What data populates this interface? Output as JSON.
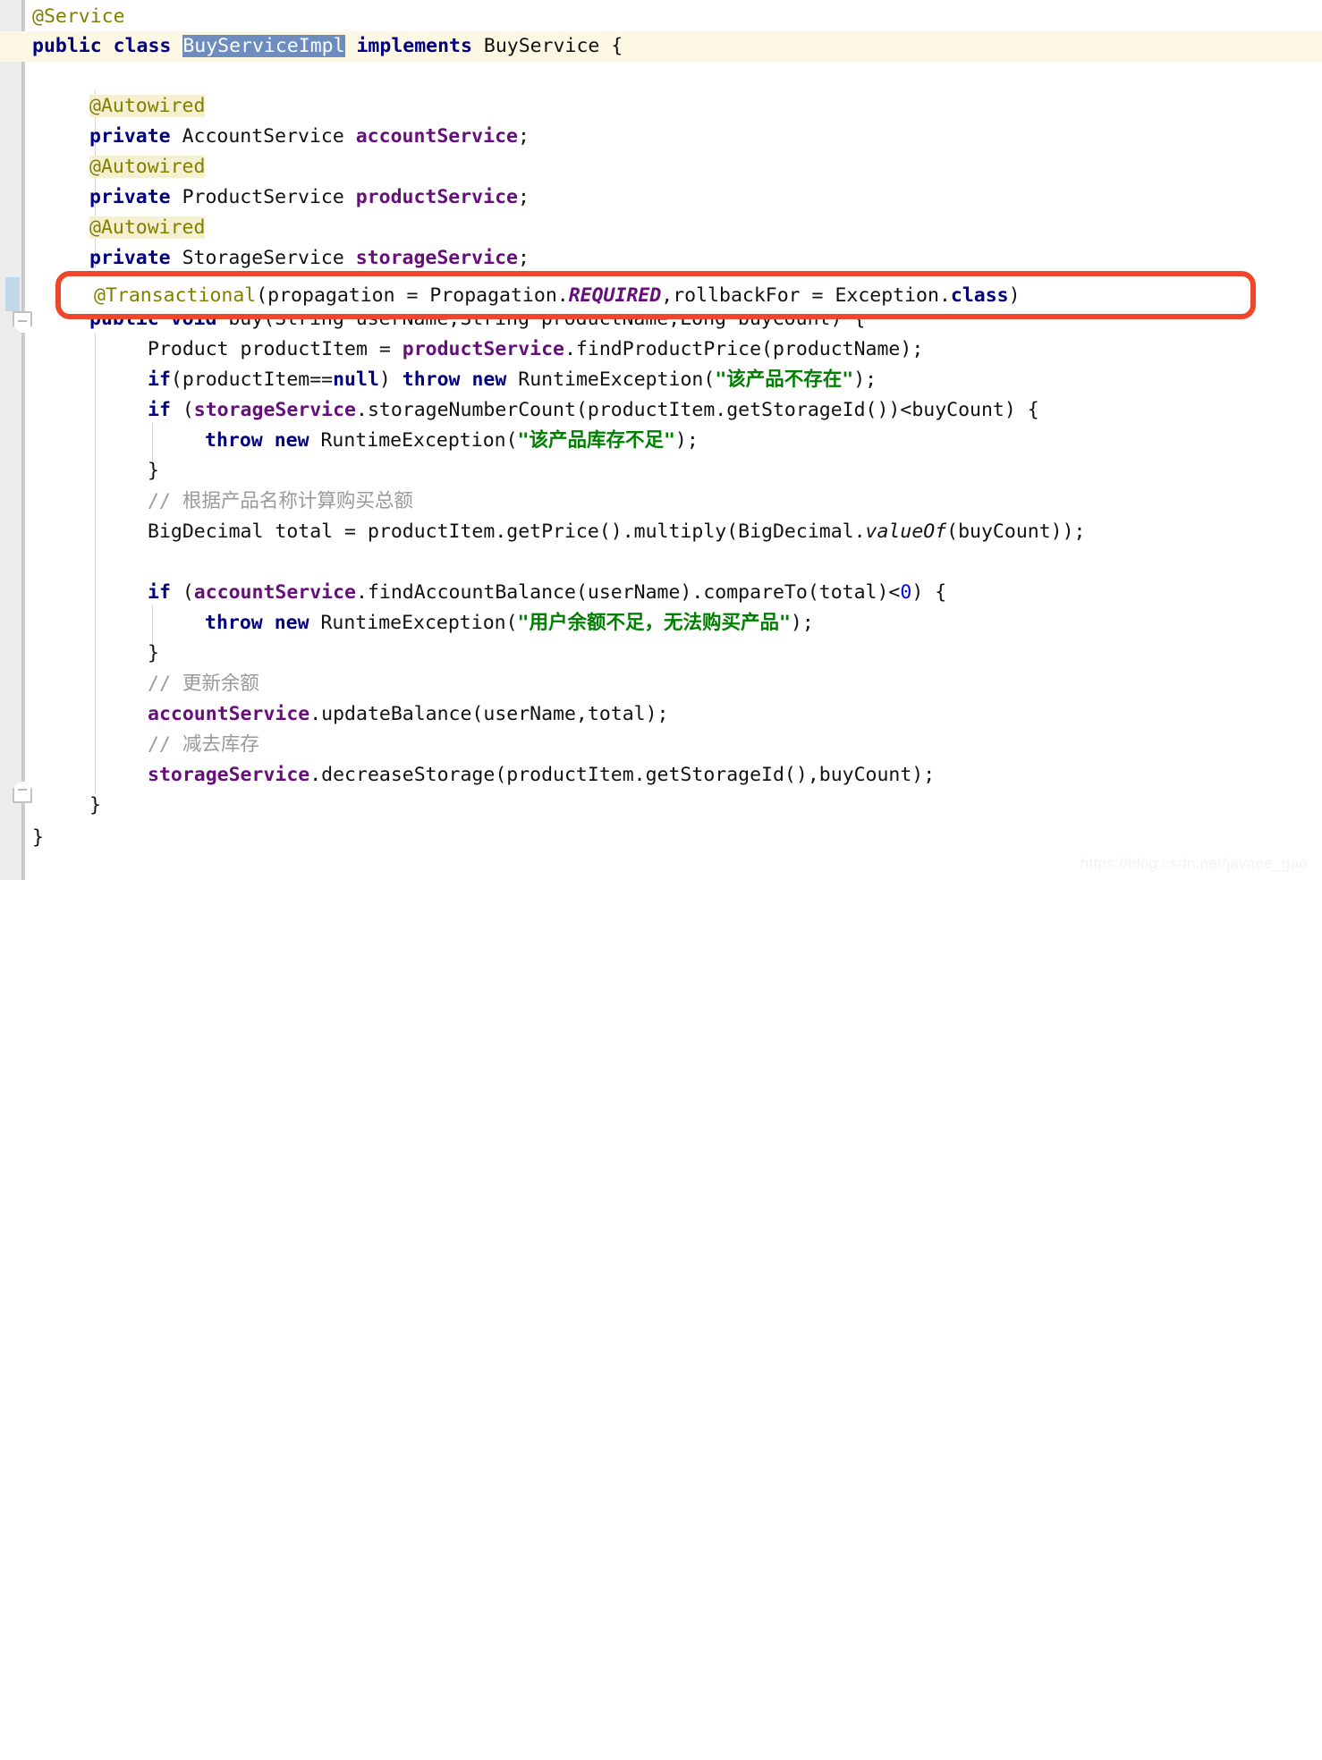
{
  "editor": {
    "watermark": "https://blog.csdn.net/javaee_gao",
    "highlight_box_color": "#f0462c",
    "selection_color": "#6d8cc0",
    "caret_line_color": "#fdf8e4",
    "gutter_color": "#ececec",
    "change_bar_color": "#c3d7ea"
  },
  "code": {
    "line1": {
      "annotation": "@Service"
    },
    "line2": {
      "kw_public": "public",
      "kw_class": "class",
      "class_name": "BuyServiceImpl",
      "kw_implements": "implements",
      "interface_name": "BuyService",
      "brace": "{"
    },
    "line4": {
      "annotation": "@Autowired"
    },
    "line5": {
      "kw_private": "private",
      "type": "AccountService",
      "field": "accountService",
      "semi": ";"
    },
    "line6": {
      "annotation": "@Autowired"
    },
    "line7": {
      "kw_private": "private",
      "type": "ProductService",
      "field": "productService",
      "semi": ";"
    },
    "line8": {
      "annotation": "@Autowired"
    },
    "line9": {
      "kw_private": "private",
      "type": "StorageService",
      "field": "storageService",
      "semi": ";"
    },
    "line10_hidden": "@Transactional(propagation = Propagation.REQUIRED)",
    "line_transactional": {
      "annotation": "@Transactional",
      "open": "(propagation = Propagation.",
      "propagation_value": "REQUIRED",
      "mid": ",rollbackFor = Exception.",
      "kw_class": "class",
      "close": ")"
    },
    "line_signature": {
      "kw_public": "public",
      "kw_void": "void",
      "method": "buy(String userName,String productName,Long buyCount) {"
    },
    "line_product": {
      "prefix": "Product productItem = ",
      "field": "productService",
      "suffix": ".findProductPrice(productName);"
    },
    "line_ifnull": {
      "kw_if": "if",
      "cond_a": "(productItem==",
      "kw_null": "null",
      "cond_b": ") ",
      "kw_throw": "throw",
      "kw_new": "new",
      "call": " RuntimeException(",
      "string": "\"该产品不存在\"",
      "tail": ");"
    },
    "line_ifstorage": {
      "kw_if": "if",
      "open": " (",
      "field": "storageService",
      "suffix": ".storageNumberCount(productItem.getStorageId())<buyCount) {"
    },
    "line_throw_stock": {
      "kw_throw": "throw",
      "kw_new": "new",
      "call": " RuntimeException(",
      "string": "\"该产品库存不足\"",
      "tail": ");"
    },
    "line_close_brace_1": "}",
    "comment_total": "// 根据产品名称计算购买总额",
    "line_bigdecimal": {
      "prefix": "BigDecimal total = productItem.getPrice().multiply(BigDecimal.",
      "static_method": "valueOf",
      "suffix": "(buyCount));"
    },
    "line_ifbalance": {
      "kw_if": "if",
      "open": " (",
      "field": "accountService",
      "mid": ".findAccountBalance(userName).compareTo(total)<",
      "num": "0",
      "tail": ") {"
    },
    "line_throw_balance": {
      "kw_throw": "throw",
      "kw_new": "new",
      "call": " RuntimeException(",
      "string": "\"用户余额不足，无法购买产品\"",
      "tail": ");"
    },
    "line_close_brace_2": "}",
    "comment_update_balance": "// 更新余额",
    "line_update": {
      "field": "accountService",
      "suffix": ".updateBalance(userName,total);"
    },
    "comment_decrease_stock": "// 减去库存",
    "line_decrease": {
      "field": "storageService",
      "suffix": ".decreaseStorage(productItem.getStorageId(),buyCount);"
    },
    "line_close_method": "}",
    "line_close_class": "}"
  }
}
